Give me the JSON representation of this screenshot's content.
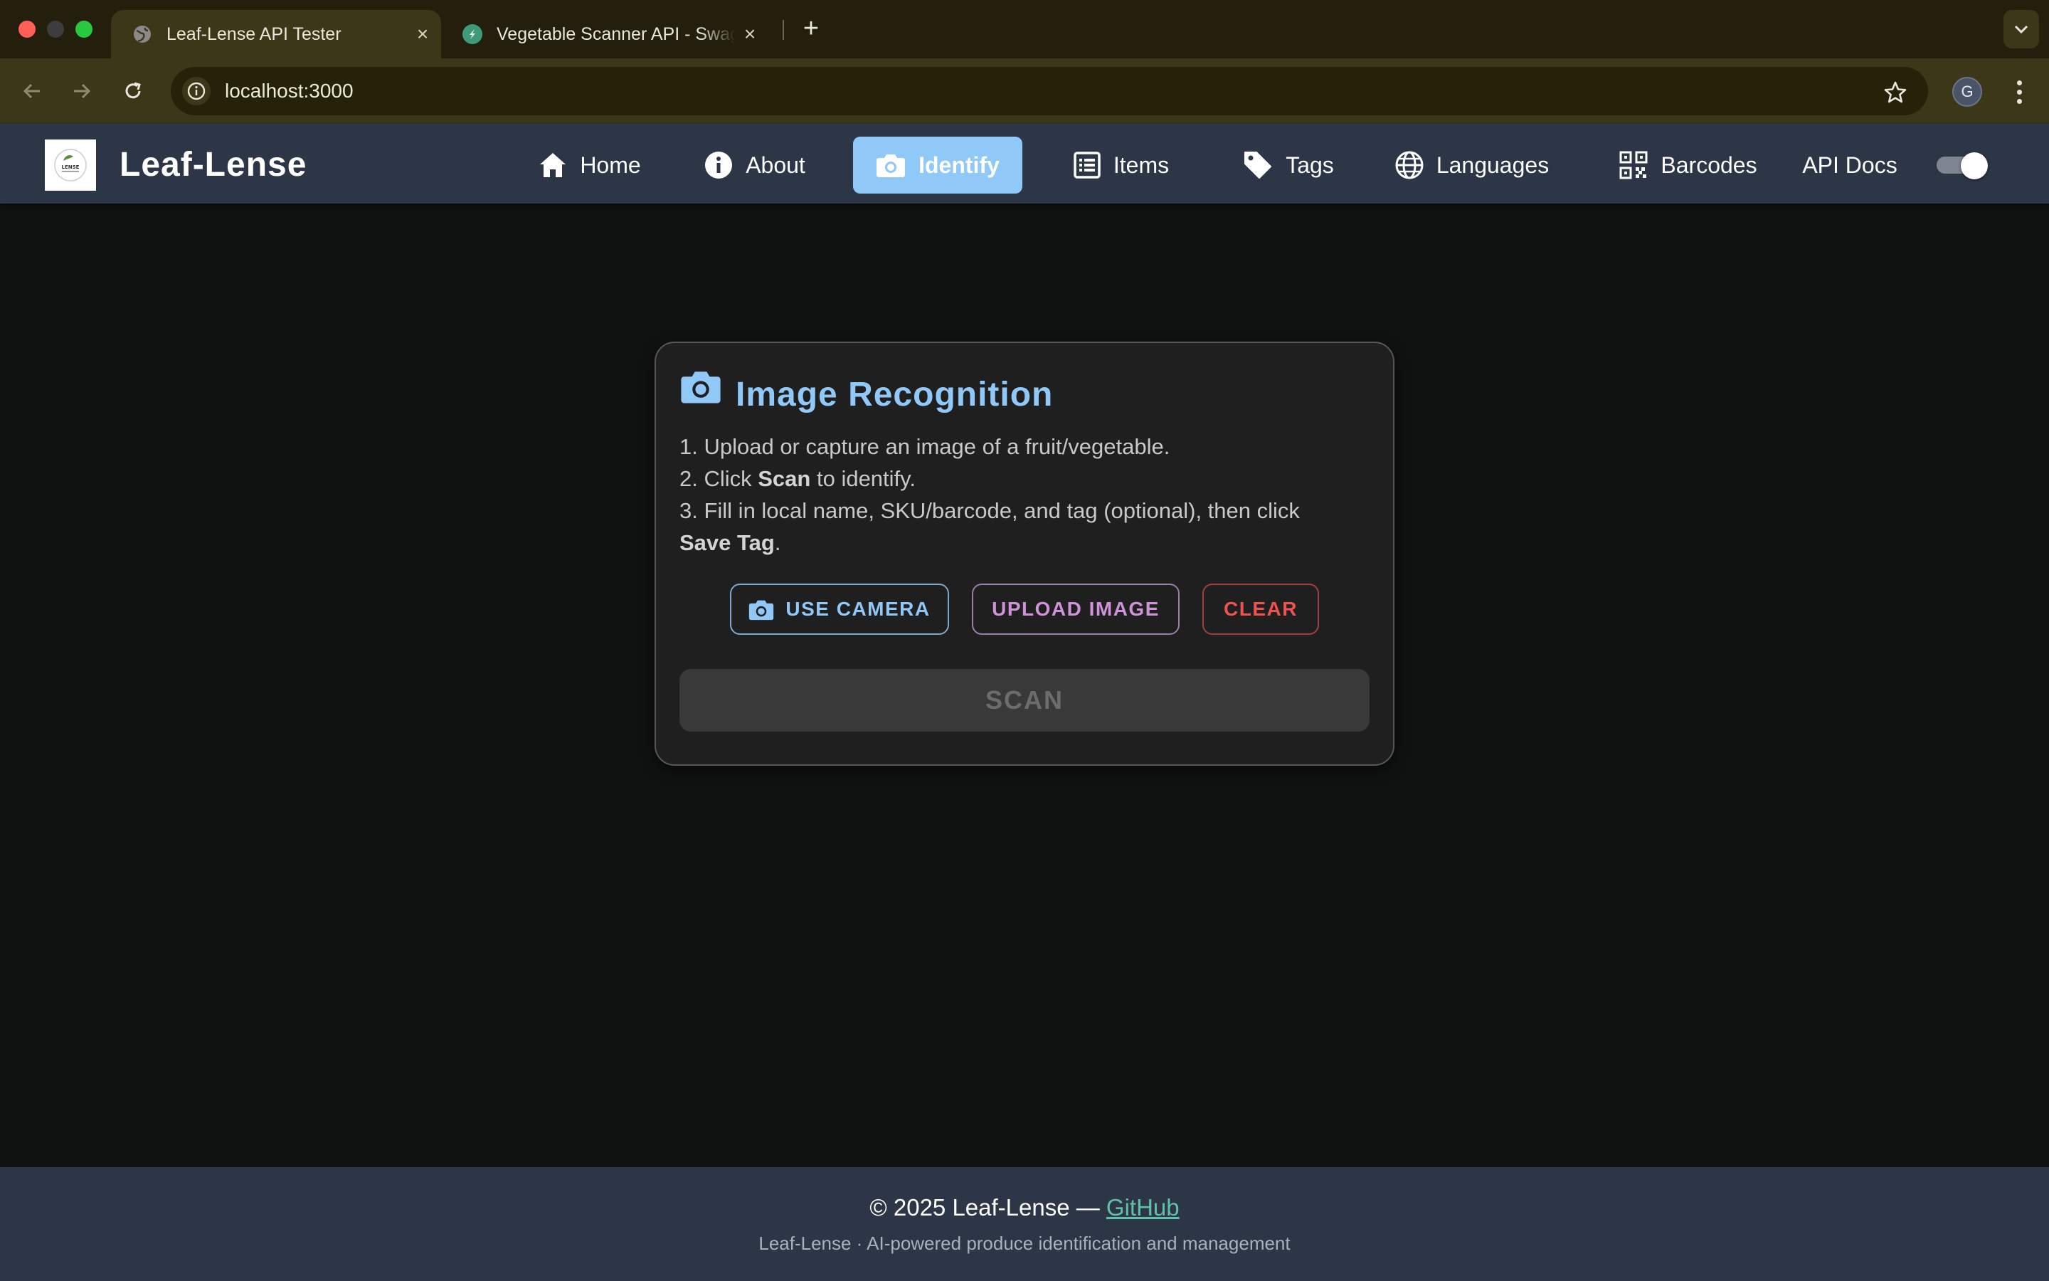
{
  "browser": {
    "tabs": [
      {
        "title": "Leaf-Lense API Tester",
        "icon": "globe-icon",
        "active": true
      },
      {
        "title": "Vegetable Scanner API - Swagger UI",
        "icon": "swagger-icon",
        "active": false
      }
    ],
    "new_tab_label": "+",
    "url": "localhost:3000",
    "profile_initial": "G"
  },
  "app": {
    "brand": "Leaf-Lense",
    "logo_text": "LENSE",
    "nav": [
      {
        "label": "Home",
        "icon": "home-icon"
      },
      {
        "label": "About",
        "icon": "info-icon"
      },
      {
        "label": "Identify",
        "icon": "camera-icon",
        "active": true
      },
      {
        "label": "Items",
        "icon": "list-icon"
      },
      {
        "label": "Tags",
        "icon": "tag-icon"
      },
      {
        "label": "Languages",
        "icon": "globe-icon"
      },
      {
        "label": "Barcodes",
        "icon": "qr-code-icon"
      },
      {
        "label": "API Docs"
      }
    ],
    "theme_toggle_on": true
  },
  "card": {
    "title": "Image Recognition",
    "steps": {
      "s1": "1. Upload or capture an image of a fruit/vegetable.",
      "s2_pre": "2. Click ",
      "s2_bold": "Scan",
      "s2_post": " to identify.",
      "s3_line1": "3. Fill in local name, SKU/barcode, and tag (optional), then click",
      "s3_bold": "Save Tag",
      "s3_post": "."
    },
    "buttons": {
      "camera": "USE CAMERA",
      "upload": "UPLOAD IMAGE",
      "clear": "CLEAR",
      "scan": "SCAN"
    }
  },
  "footer": {
    "copyright": "© 2025 Leaf-Lense — ",
    "github": "GitHub",
    "tagline": "Leaf-Lense · AI-powered produce identification and management"
  },
  "colors": {
    "accent": "#90c8f8",
    "upload": "#ce93d8",
    "clear": "#ef5350",
    "navbar": "#2c3646",
    "footer_link": "#5fc2a8"
  }
}
